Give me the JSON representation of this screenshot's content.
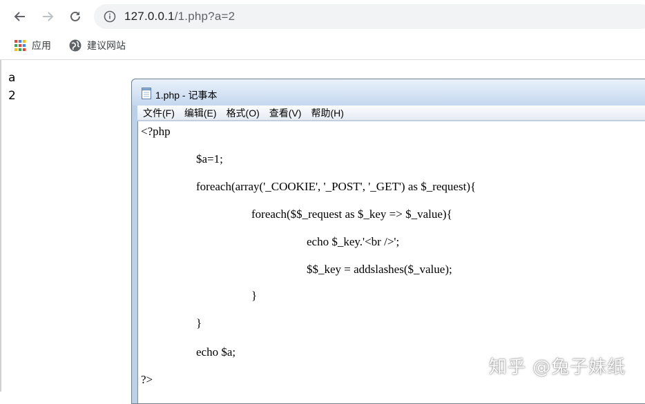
{
  "browser": {
    "url_host": "127.0.0.1",
    "url_rest": "/1.php?a=2",
    "bookmarks": [
      {
        "label": "应用"
      },
      {
        "label": "建议网站"
      }
    ]
  },
  "page_output": {
    "lines": [
      "a",
      "2"
    ]
  },
  "notepad": {
    "title": "1.php - 记事本",
    "menu": [
      "文件(F)",
      "编辑(E)",
      "格式(O)",
      "查看(V)",
      "帮助(H)"
    ],
    "code": [
      "<?php",
      "$a=1;",
      "foreach(array('_COOKIE', '_POST', '_GET') as $_request){",
      "foreach($$_request as $_key => $_value){",
      "echo $_key.'<br />';",
      "$$_key = addslashes($_value);",
      "}",
      "}",
      "echo $a;",
      "?>"
    ]
  },
  "watermark": "知乎 @兔子妹纸"
}
